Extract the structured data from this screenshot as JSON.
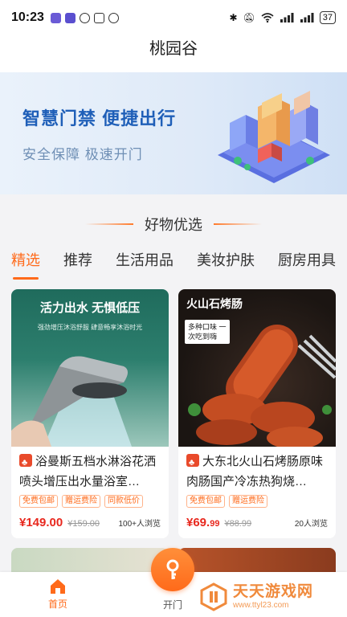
{
  "status_bar": {
    "time": "10:23",
    "battery": "37"
  },
  "header": {
    "title": "桃园谷"
  },
  "banner": {
    "title": "智慧门禁 便捷出行",
    "subtitle": "安全保障 极速开门"
  },
  "section": {
    "title": "好物优选"
  },
  "tabs": [
    {
      "label": "精选",
      "active": true
    },
    {
      "label": "推荐"
    },
    {
      "label": "生活用品"
    },
    {
      "label": "美妆护肤"
    },
    {
      "label": "厨房用具"
    }
  ],
  "products": [
    {
      "image_headline": "活力出水 无惧低压",
      "image_subline": "强劲增压沐浴舒服 肆意畅享沐浴时光",
      "name": "浴曼斯五档水淋浴花洒喷头增压出水量浴室…",
      "tags": [
        "免费包邮",
        "赠运费险",
        "同款低价"
      ],
      "price": "¥149.00",
      "original_price": "¥159.00",
      "views": "100+人浏览"
    },
    {
      "image_headline": "火山石烤肠",
      "image_subline": "多种口味 一次吃到嗨",
      "name": "大东北火山石烤肠原味肉肠国产冷冻热狗烧…",
      "tags": [
        "免费包邮",
        "赠运费险"
      ],
      "price_int": "¥69.",
      "price_dec": "99",
      "original_price": "¥88.99",
      "views": "20人浏览"
    }
  ],
  "tabbar": {
    "home_label": "首页",
    "open_label": "开门"
  },
  "watermark": {
    "title": "天天游戏网",
    "url": "www.ttyl23.com"
  },
  "colors": {
    "accent": "#ff6a1a",
    "price": "#e8281e",
    "banner_title": "#1f5fb8"
  }
}
